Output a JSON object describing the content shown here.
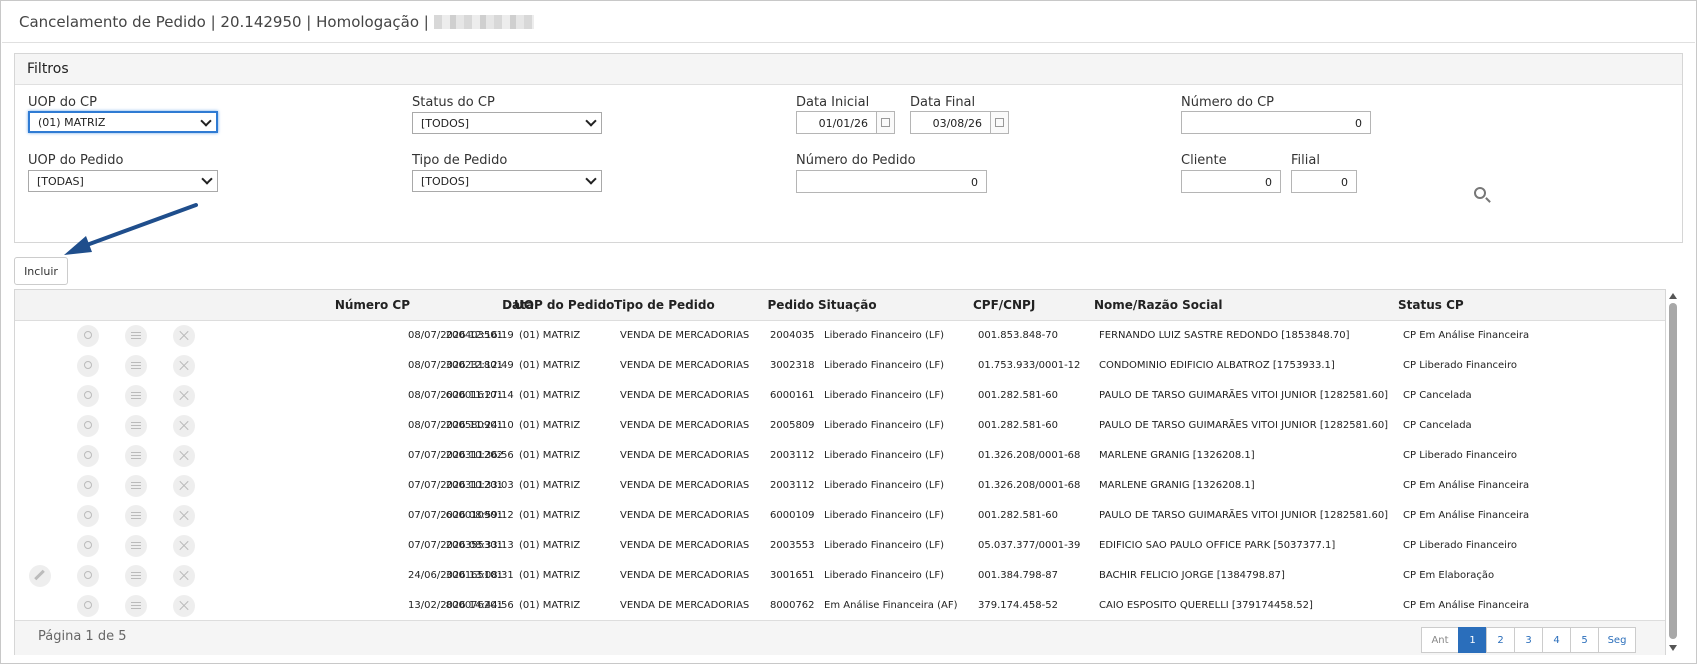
{
  "header": {
    "title": "Cancelamento de Pedido | 20.142950 | Homologação |"
  },
  "filters": {
    "title": "Filtros",
    "uop_cp": {
      "label": "UOP do CP",
      "value": "(01) MATRIZ"
    },
    "status_cp": {
      "label": "Status do CP",
      "value": "[TODOS]"
    },
    "data_inicial": {
      "label": "Data Inicial",
      "value": "01/01/26"
    },
    "data_final": {
      "label": "Data Final",
      "value": "03/08/26"
    },
    "numero_cp": {
      "label": "Número do CP",
      "value": "0"
    },
    "uop_pedido": {
      "label": "UOP do Pedido",
      "value": "[TODAS]"
    },
    "tipo_pedido": {
      "label": "Tipo de Pedido",
      "value": "[TODOS]"
    },
    "numero_pedido": {
      "label": "Número do Pedido",
      "value": "0"
    },
    "cliente": {
      "label": "Cliente",
      "value": "0"
    },
    "filial": {
      "label": "Filial",
      "value": "0"
    }
  },
  "actions": {
    "incluir": "Incluir"
  },
  "table": {
    "columns": [
      "Número CP",
      "Data",
      "UOP do Pedido",
      "Tipo de Pedido",
      "Pedido",
      "Situação",
      "CPF/CNPJ",
      "Nome/Razão Social",
      "Status CP"
    ],
    "rows": [
      [
        "200403501",
        "08/07/2026 12:16:19",
        "(01) MATRIZ",
        "VENDA DE MERCADORIAS",
        "2004035",
        "Liberado Financeiro (LF)",
        "001.853.848-70",
        "FERNANDO LUIZ SASTRE REDONDO [1853848.70]",
        "CP Em Análise Financeira"
      ],
      [
        "300231801",
        "08/07/2026 12:12:49",
        "(01) MATRIZ",
        "VENDA DE MERCADORIAS",
        "3002318",
        "Liberado Financeiro (LF)",
        "01.753.933/0001-12",
        "CONDOMINIO EDIFICIO ALBATROZ [1753933.1]",
        "CP Liberado Financeiro"
      ],
      [
        "600016101",
        "08/07/2026 11:27:14",
        "(01) MATRIZ",
        "VENDA DE MERCADORIAS",
        "6000161",
        "Liberado Financeiro (LF)",
        "001.282.581-60",
        "PAULO DE TARSO GUIMARÃES VITOI JUNIOR [1282581.60]",
        "CP Cancelada"
      ],
      [
        "200580901",
        "08/07/2026 11:24:10",
        "(01) MATRIZ",
        "VENDA DE MERCADORIAS",
        "2005809",
        "Liberado Financeiro (LF)",
        "001.282.581-60",
        "PAULO DE TARSO GUIMARÃES VITOI JUNIOR [1282581.60]",
        "CP Cancelada"
      ],
      [
        "200311202",
        "07/07/2026 10:36:56",
        "(01) MATRIZ",
        "VENDA DE MERCADORIAS",
        "2003112",
        "Liberado Financeiro (LF)",
        "01.326.208/0001-68",
        "MARLENE GRANIG [1326208.1]",
        "CP Liberado Financeiro"
      ],
      [
        "200311201",
        "07/07/2026 10:33:03",
        "(01) MATRIZ",
        "VENDA DE MERCADORIAS",
        "2003112",
        "Liberado Financeiro (LF)",
        "01.326.208/0001-68",
        "MARLENE GRANIG [1326208.1]",
        "CP Em Análise Financeira"
      ],
      [
        "600010901",
        "07/07/2026 08:59:12",
        "(01) MATRIZ",
        "VENDA DE MERCADORIAS",
        "6000109",
        "Liberado Financeiro (LF)",
        "001.282.581-60",
        "PAULO DE TARSO GUIMARÃES VITOI JUNIOR [1282581.60]",
        "CP Em Análise Financeira"
      ],
      [
        "200355301",
        "07/07/2026 08:33:13",
        "(01) MATRIZ",
        "VENDA DE MERCADORIAS",
        "2003553",
        "Liberado Financeiro (LF)",
        "05.037.377/0001-39",
        "EDIFICIO SAO PAULO OFFICE PARK [5037377.1]",
        "CP Liberado Financeiro"
      ],
      [
        "300165101",
        "24/06/2026 13:08:31",
        "(01) MATRIZ",
        "VENDA DE MERCADORIAS",
        "3001651",
        "Liberado Financeiro (LF)",
        "001.384.798-87",
        "BACHIR FELICIO JORGE [1384798.87]",
        "CP Em Elaboração"
      ],
      [
        "800076201",
        "13/02/2026 14:44:56",
        "(01) MATRIZ",
        "VENDA DE MERCADORIAS",
        "8000762",
        "Em Análise Financeira (AF)",
        "379.174.458-52",
        "CAIO ESPOSITO QUERELLI [379174458.52]",
        "CP Em Análise Financeira"
      ]
    ],
    "editable_rows": [
      8
    ]
  },
  "footer": {
    "page_info": "Página 1 de 5",
    "pager": [
      "Ant",
      "1",
      "2",
      "3",
      "4",
      "5",
      "Seg"
    ],
    "active_page": "1"
  }
}
